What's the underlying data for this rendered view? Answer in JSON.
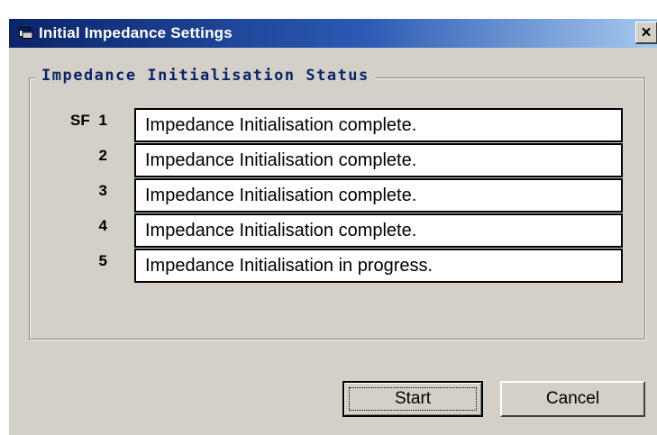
{
  "window": {
    "title": "Initial Impedance Settings",
    "close_label": "×"
  },
  "group": {
    "legend": "Impedance Initialisation Status",
    "sf_label": "SF",
    "rows": [
      {
        "num": "1",
        "status": "Impedance Initialisation complete."
      },
      {
        "num": "2",
        "status": "Impedance Initialisation complete."
      },
      {
        "num": "3",
        "status": "Impedance Initialisation complete."
      },
      {
        "num": "4",
        "status": "Impedance Initialisation complete."
      },
      {
        "num": "5",
        "status": "Impedance Initialisation in progress."
      }
    ]
  },
  "buttons": {
    "start_label": "Start",
    "cancel_label": "Cancel"
  },
  "colors": {
    "title_bar": "#0a246a",
    "face": "#d4d0c8",
    "legend_text": "#0a246a"
  }
}
